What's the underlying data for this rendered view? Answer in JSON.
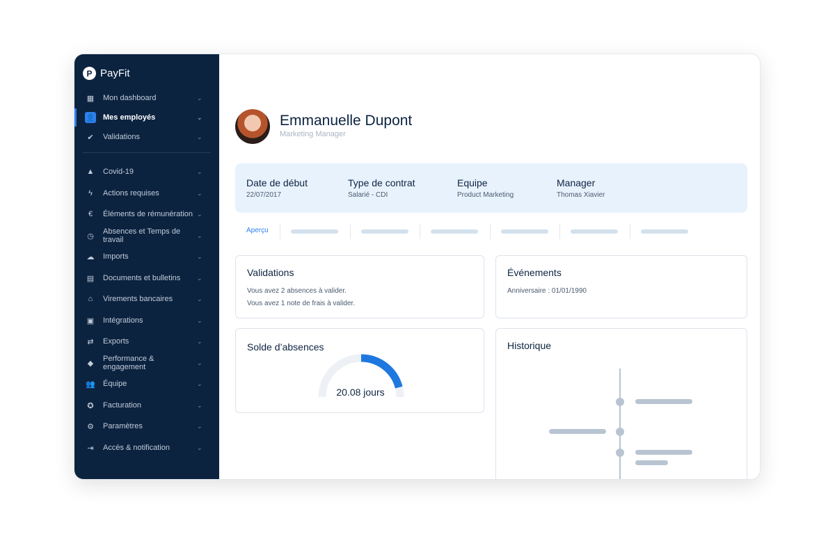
{
  "app": {
    "name": "PayFit"
  },
  "sidebar": {
    "items": [
      {
        "label": "Mon dashboard",
        "icon": "dashboard-icon"
      },
      {
        "label": "Mes employés",
        "icon": "user-icon",
        "active": true
      },
      {
        "label": "Validations",
        "icon": "check-circle-icon"
      },
      {
        "label": "Covid-19",
        "icon": "warning-icon"
      },
      {
        "label": "Actions requises",
        "icon": "bolt-icon"
      },
      {
        "label": "Éléments de rémunération",
        "icon": "euro-icon"
      },
      {
        "label": "Absences et Temps de travail",
        "icon": "clock-icon"
      },
      {
        "label": "Imports",
        "icon": "cloud-upload-icon"
      },
      {
        "label": "Documents et bulletins",
        "icon": "document-icon"
      },
      {
        "label": "Virements bancaires",
        "icon": "bank-icon"
      },
      {
        "label": "Intégrations",
        "icon": "clipboard-icon"
      },
      {
        "label": "Exports",
        "icon": "arrows-icon"
      },
      {
        "label": "Performance & engagement",
        "icon": "widgets-icon"
      },
      {
        "label": "Équipe",
        "icon": "team-icon"
      },
      {
        "label": "Facturation",
        "icon": "star-icon"
      },
      {
        "label": "Paramètres",
        "icon": "gear-icon"
      },
      {
        "label": "Accès & notification",
        "icon": "login-icon"
      }
    ]
  },
  "employee": {
    "name": "Emmanuelle Dupont",
    "role": "Marketing Manager"
  },
  "info": [
    {
      "label": "Date de début",
      "value": "22/07/2017"
    },
    {
      "label": "Type de contrat",
      "value": "Salarié - CDI"
    },
    {
      "label": "Equipe",
      "value": "Product Marketing"
    },
    {
      "label": "Manager",
      "value": "Thomas Xiavier"
    }
  ],
  "tabs": {
    "active": "Aperçu"
  },
  "validations": {
    "title": "Validations",
    "lines": [
      "Vous avez 2 absences à valider.",
      "Vous avez 1 note de frais à valider."
    ]
  },
  "events": {
    "title": "Événements",
    "lines": [
      "Anniversaire : 01/01/1990"
    ]
  },
  "absences": {
    "title": "Solde d’absences",
    "value": "20.08 jours",
    "fraction": 0.42
  },
  "history": {
    "title": "Historique"
  },
  "colors": {
    "sidebar": "#0c2340",
    "accent": "#2f80ed",
    "info_bg": "#e8f2fd"
  }
}
